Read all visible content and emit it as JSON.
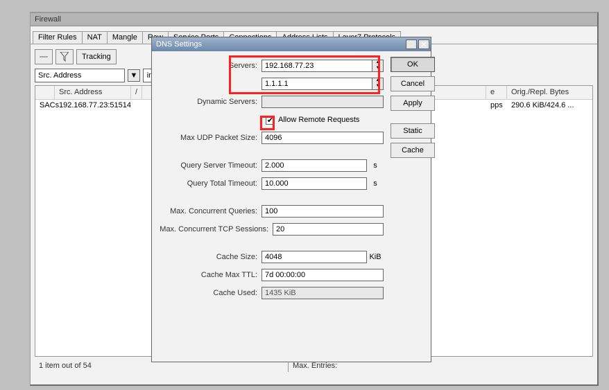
{
  "firewall": {
    "title": "Firewall",
    "tabs": [
      "Filter Rules",
      "NAT",
      "Mangle",
      "Raw",
      "Service Ports",
      "Connections",
      "Address Lists",
      "Layer7 Protocols"
    ],
    "active_tab": "Connections",
    "tracking_btn": "Tracking",
    "filter_field": "Src. Address",
    "filter_cond": "in",
    "columns": {
      "blank": "",
      "src": "Src. Address",
      "sort": "/",
      "extra": "e",
      "bytes": "Orig./Repl. Bytes"
    },
    "rows": [
      {
        "tag": "SACs",
        "src": "192.168.77.23:51514",
        "extra": "pps",
        "bytes": "290.6 KiB/424.6 ..."
      }
    ],
    "status": "1 item out of 54",
    "max_entries_label": "Max. Entries:"
  },
  "dns": {
    "title": "DNS Settings",
    "servers_label": "Servers:",
    "server1": "192.168.77.23",
    "server2": "1.1.1.1",
    "dynamic_label": "Dynamic Servers:",
    "dynamic_value": "",
    "allow_remote_label": "Allow Remote Requests",
    "max_udp_label": "Max UDP Packet Size:",
    "max_udp": "4096",
    "q_server_timeout_label": "Query Server Timeout:",
    "q_server_timeout": "2.000",
    "q_total_timeout_label": "Query Total Timeout:",
    "q_total_timeout": "10.000",
    "seconds": "s",
    "max_concurrent_q_label": "Max. Concurrent Queries:",
    "max_concurrent_q": "100",
    "max_tcp_label": "Max. Concurrent TCP Sessions:",
    "max_tcp": "20",
    "cache_size_label": "Cache Size:",
    "cache_size": "4048",
    "kib": "KiB",
    "cache_ttl_label": "Cache Max TTL:",
    "cache_ttl": "7d 00:00:00",
    "cache_used_label": "Cache Used:",
    "cache_used": "1435 KiB",
    "buttons": {
      "ok": "OK",
      "cancel": "Cancel",
      "apply": "Apply",
      "static": "Static",
      "cache": "Cache"
    }
  }
}
